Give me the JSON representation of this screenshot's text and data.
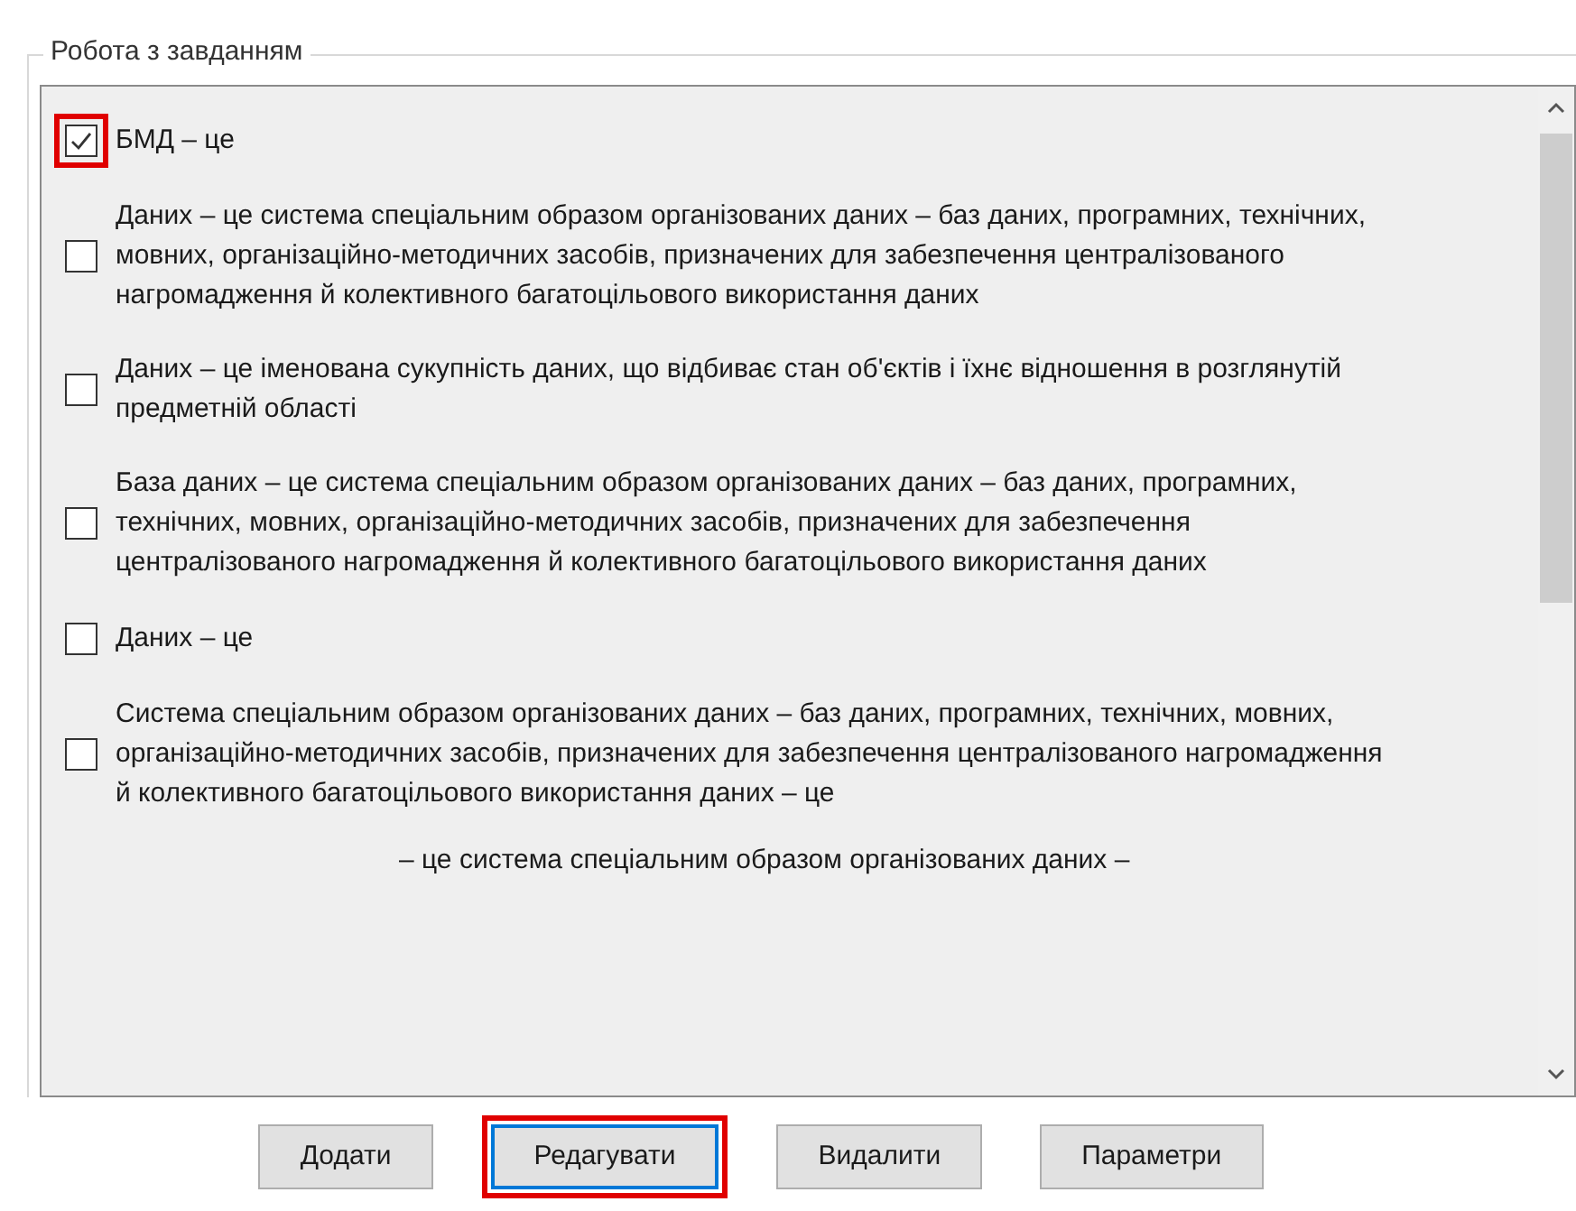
{
  "group": {
    "title": "Робота з завданням"
  },
  "items": [
    {
      "text": "БМД – це",
      "checked": true,
      "highlighted": true
    },
    {
      "text": "Даних – це система спеціальним образом організованих даних – баз даних, програмних, технічних, мовних, організаційно-методичних засобів, призначених для забезпечення централізованого нагромадження й колективного багатоцільового використання даних",
      "checked": false,
      "highlighted": false
    },
    {
      "text": "Даних – це іменована сукупність даних, що відбиває стан об'єктів і їхнє відношення в розглянутій предметній області",
      "checked": false,
      "highlighted": false
    },
    {
      "text": "База даних – це система спеціальним образом організованих даних – баз даних, програмних, технічних, мовних, організаційно-методичних засобів, призначених для забезпечення централізованого нагромадження й колективного багатоцільового використання даних",
      "checked": false,
      "highlighted": false
    },
    {
      "text": "Даних – це",
      "checked": false,
      "highlighted": false
    },
    {
      "text": "Система спеціальним образом організованих даних – баз даних, програмних, технічних, мовних, організаційно-методичних засобів, призначених для забезпечення централізованого нагромадження й колективного багатоцільового використання даних – це",
      "checked": false,
      "highlighted": false
    }
  ],
  "partial_line": "– це система спеціальним образом організованих даних –",
  "buttons": [
    {
      "label": "Додати",
      "focused": false,
      "highlighted": false
    },
    {
      "label": "Редагувати",
      "focused": true,
      "highlighted": true
    },
    {
      "label": "Видалити",
      "focused": false,
      "highlighted": false
    },
    {
      "label": "Параметри",
      "focused": false,
      "highlighted": false
    }
  ]
}
